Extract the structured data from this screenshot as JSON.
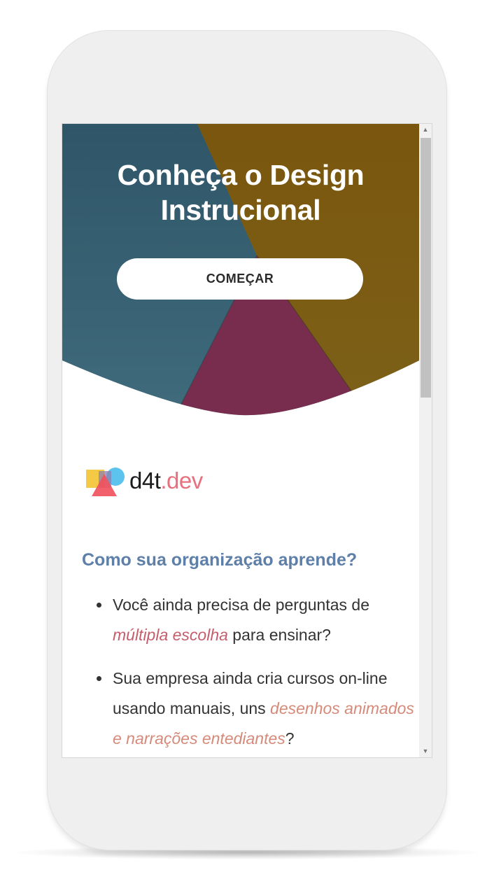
{
  "hero": {
    "title_line1": "Conheça o Design",
    "title_line2": "Instrucional",
    "cta_label": "COMEÇAR",
    "colors": {
      "teal": "#3b6678",
      "ochre": "#7e5d16",
      "plum": "#7a2d4f"
    }
  },
  "logo": {
    "part1": "d4t",
    "part2": ".dev"
  },
  "section": {
    "heading": "Como sua organização aprende?",
    "bullets": [
      {
        "pre": "Você ainda precisa de perguntas de ",
        "em": "múltipla escolha",
        "post": " para ensinar?"
      },
      {
        "pre": "Sua empresa ainda cria cursos on-line usando manuais, uns ",
        "em": "desenhos animados e narrações entediantes",
        "post": "?"
      }
    ]
  },
  "colors": {
    "heading": "#5d7fa8",
    "emphasis_red": "#c45e6c",
    "emphasis_salmon": "#d58a7a",
    "device": "#efefef"
  }
}
